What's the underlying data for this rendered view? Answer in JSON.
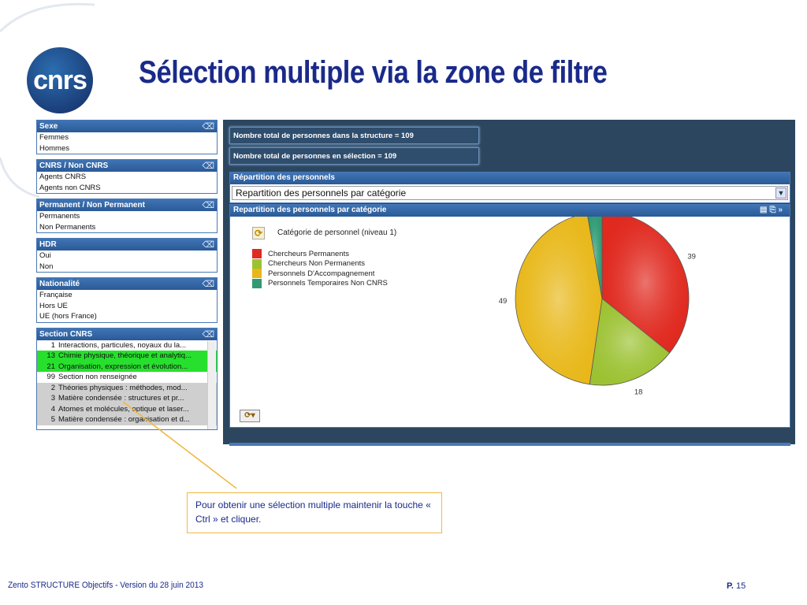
{
  "slide": {
    "title": "Sélection multiple via la zone de filtre",
    "logo_text": "cnrs",
    "footer": "Zento STRUCTURE Objectifs - Version du 28 juin 2013",
    "page_prefix": "P.",
    "page_number": "15",
    "note": "Pour obtenir une sélection multiple  maintenir la touche « Ctrl » et cliquer."
  },
  "filters": [
    {
      "title": "Sexe",
      "items": [
        "Femmes",
        "Hommes"
      ]
    },
    {
      "title": "CNRS / Non CNRS",
      "items": [
        "Agents CNRS",
        "Agents non CNRS"
      ]
    },
    {
      "title": "Permanent / Non Permanent",
      "items": [
        "Permanents",
        "Non Permanents"
      ]
    },
    {
      "title": "HDR",
      "items": [
        "Oui",
        "Non"
      ]
    },
    {
      "title": "Nationalité",
      "items": [
        "Française",
        "Hors UE",
        "UE (hors France)"
      ]
    }
  ],
  "section": {
    "title": "Section CNRS",
    "items": [
      {
        "num": "1",
        "label": "Interactions, particules, noyaux du la...",
        "state": "normal"
      },
      {
        "num": "13",
        "label": "Chimie physique, théorique et analytiq...",
        "state": "selected"
      },
      {
        "num": "21",
        "label": "Organisation, expression et évolution...",
        "state": "selected"
      },
      {
        "num": "99",
        "label": "Section non renseignée",
        "state": "normal"
      },
      {
        "num": "2",
        "label": "Théories physiques : méthodes, mod...",
        "state": "excluded"
      },
      {
        "num": "3",
        "label": "Matière condensée : structures et pr...",
        "state": "excluded"
      },
      {
        "num": "4",
        "label": "Atomes et molécules, optique et laser...",
        "state": "excluded"
      },
      {
        "num": "5",
        "label": "Matière condensée : organisation et d...",
        "state": "excluded"
      }
    ]
  },
  "stats": {
    "total_structure": "Nombre total de personnes dans la structure = 109",
    "total_selection": "Nombre total de personnes en sélection = 109"
  },
  "repartition": {
    "header": "Répartition des personnels",
    "dropdown_value": "Repartition des personnels par catégorie",
    "chart_header": "Repartition des personnels par catégorie",
    "legend_title": "Catégorie de personnel (niveau 1)"
  },
  "chart_data": {
    "type": "pie",
    "title": "Repartition des personnels par catégorie",
    "legend_title": "Catégorie de personnel (niveau 1)",
    "categories": [
      "Chercheurs Permanents",
      "Chercheurs Non Permanents",
      "Personnels D'Accompagnement",
      "Personnels Temporaires Non CNRS"
    ],
    "values": [
      39,
      18,
      49,
      3
    ],
    "colors": [
      "#e0291f",
      "#9cc233",
      "#e8b81a",
      "#2f9a74"
    ]
  }
}
